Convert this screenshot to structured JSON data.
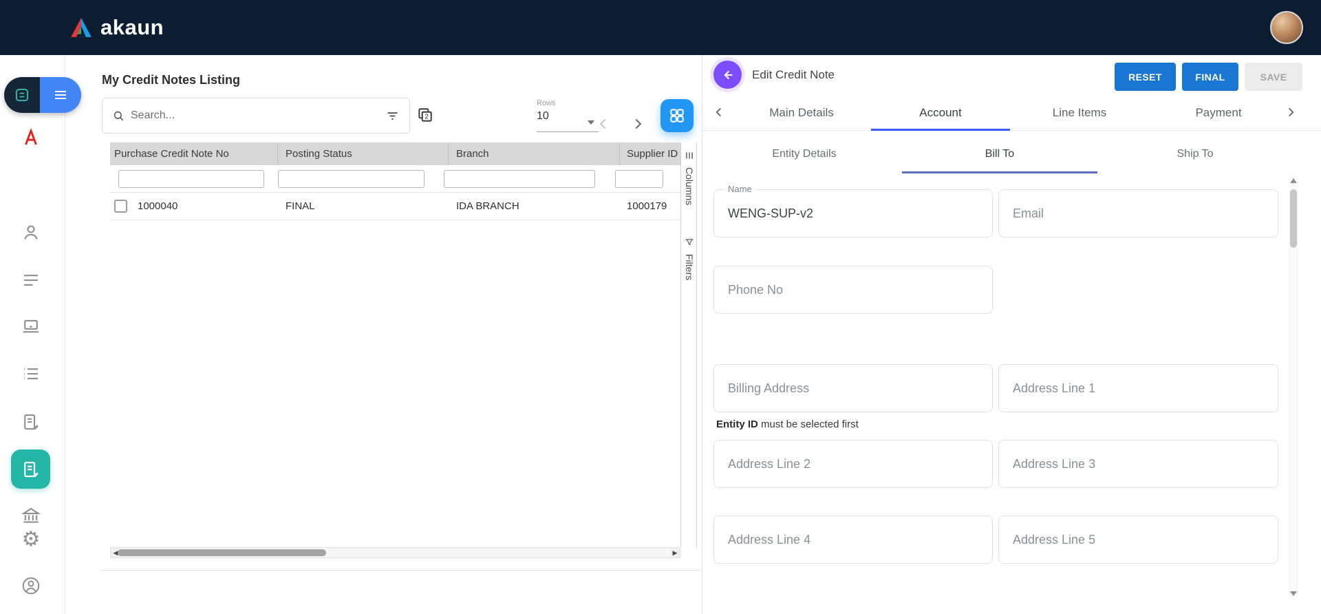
{
  "colors": {
    "topbar_bg": "#0c1d31",
    "action_blue": "#1976d2",
    "grid_button_blue": "#2196f3",
    "toggle_blue": "#4285f4",
    "active_sidebar_teal": "#24b7a7",
    "back_button_purple": "#7c4dff",
    "tab_indicator_blue": "#3d5afe",
    "subtab_indicator_indigo": "#5c6bc0",
    "logo_red": "#e03a3e",
    "logo_blue": "#1b9de2"
  },
  "topbar": {
    "logo_text": "akaun"
  },
  "sidebar": {
    "items": [
      {
        "icon": "app-badge-icon"
      },
      {
        "icon": "menu-toggle-icon"
      },
      {
        "icon": "pdf-icon"
      },
      {
        "icon": "person-icon"
      },
      {
        "icon": "list-icon"
      },
      {
        "icon": "laptop-icon"
      },
      {
        "icon": "ledger-icon"
      },
      {
        "icon": "document-edit-icon"
      },
      {
        "icon": "credit-note-icon",
        "active": true
      },
      {
        "icon": "bank-icon"
      },
      {
        "icon": "settings-gear-icon"
      },
      {
        "icon": "profile-icon"
      }
    ]
  },
  "listing": {
    "title": "My Credit Notes Listing",
    "search": {
      "placeholder": "Search..."
    },
    "rows": {
      "label": "Rows",
      "value": "10"
    },
    "side_strip": {
      "columns_label": "Columns",
      "filters_label": "Filters"
    },
    "table": {
      "headers": [
        "Purchase Credit Note No",
        "Posting Status",
        "Branch",
        "Supplier ID"
      ],
      "rows": [
        {
          "credit_note_no": "1000040",
          "posting_status": "FINAL",
          "branch": "IDA BRANCH",
          "supplier_id": "1000179"
        }
      ]
    }
  },
  "editor": {
    "title": "Edit Credit Note",
    "actions": {
      "reset": "RESET",
      "final": "FINAL",
      "save": "SAVE"
    },
    "tabs": [
      {
        "label": "Main Details",
        "active": false
      },
      {
        "label": "Account",
        "active": true
      },
      {
        "label": "Line Items",
        "active": false
      },
      {
        "label": "Payment",
        "active": false
      }
    ],
    "subtabs": [
      {
        "label": "Entity Details",
        "active": false
      },
      {
        "label": "Bill To",
        "active": true
      },
      {
        "label": "Ship To",
        "active": false
      }
    ],
    "fields": {
      "name": {
        "label": "Name",
        "value": "WENG-SUP-v2"
      },
      "email": {
        "placeholder": "Email"
      },
      "phone": {
        "placeholder": "Phone No"
      },
      "billing_address": {
        "placeholder": "Billing Address"
      },
      "address_line_1": {
        "placeholder": "Address Line 1"
      },
      "address_line_2": {
        "placeholder": "Address Line 2"
      },
      "address_line_3": {
        "placeholder": "Address Line 3"
      },
      "address_line_4": {
        "placeholder": "Address Line 4"
      },
      "address_line_5": {
        "placeholder": "Address Line 5"
      }
    },
    "helper": {
      "bold": "Entity ID",
      "text": " must be selected first"
    }
  }
}
